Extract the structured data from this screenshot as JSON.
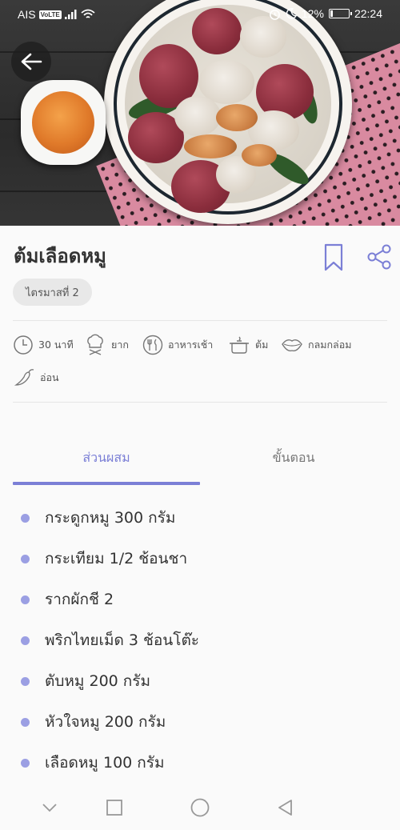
{
  "status_bar": {
    "carrier": "AIS",
    "volte": "VoLTE",
    "battery_percent": "12%",
    "battery_level": 0.12,
    "time": "22:24"
  },
  "recipe": {
    "title": "ต้มเลือดหมู",
    "tag": "ไตรมาสที่ 2",
    "info": {
      "time": "30 นาที",
      "difficulty": "ยาก",
      "meal": "อาหารเช้า",
      "method": "ต้ม",
      "taste": "กลมกล่อม",
      "spice": "อ่อน"
    }
  },
  "tabs": {
    "ingredients": "ส่วนผสม",
    "steps": "ขั้นตอน"
  },
  "ingredients": [
    "กระดูกหมู 300 กรัม",
    "กระเทียม 1/2 ช้อนชา",
    "รากผักชี 2",
    "พริกไทยเม็ด 3 ช้อนโต๊ะ",
    "ตับหมู 200 กรัม",
    "หัวใจหมู 200 กรัม",
    "เลือดหมู 100 กรัม"
  ],
  "colors": {
    "accent": "#7b7fd6",
    "bullet": "#9b9fe3"
  },
  "icons": {
    "back": "arrow-left-icon",
    "bookmark": "bookmark-icon",
    "share": "share-icon",
    "time": "clock-icon",
    "difficulty": "chef-hat-icon",
    "meal": "utensils-icon",
    "method": "pot-icon",
    "taste": "lips-icon",
    "spice": "chili-icon"
  }
}
